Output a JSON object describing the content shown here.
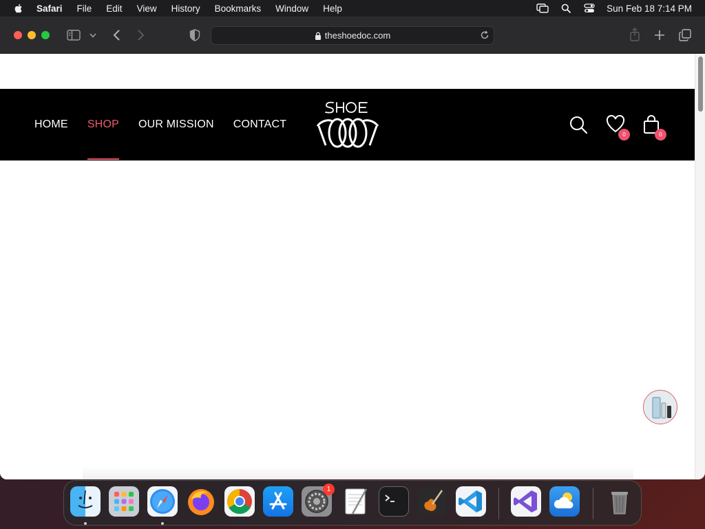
{
  "menubar": {
    "app_name": "Safari",
    "items": [
      "File",
      "Edit",
      "View",
      "History",
      "Bookmarks",
      "Window",
      "Help"
    ],
    "clock": "Sun Feb 18  7:14 PM"
  },
  "browser": {
    "url": "theshoedoc.com"
  },
  "site": {
    "nav": [
      "HOME",
      "SHOP",
      "OUR MISSION",
      "CONTACT"
    ],
    "active_nav": "SHOP",
    "accent": "#ec5a70",
    "wishlist_count": "0",
    "cart_count": "0"
  },
  "dock": {
    "apps": [
      "finder",
      "launchpad",
      "safari",
      "firefox",
      "chrome",
      "app-store",
      "system-settings",
      "textedit",
      "terminal",
      "garageband",
      "vscode",
      "visual-studio",
      "weather",
      "trash"
    ],
    "settings_badge": "1"
  }
}
